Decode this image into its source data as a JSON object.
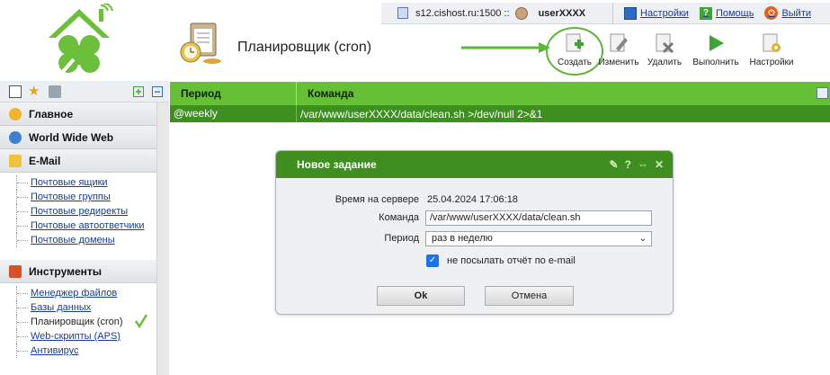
{
  "header": {
    "server": "s12.cishost.ru:1500 ::",
    "user": "userXXXX",
    "links": {
      "settings": "Настройки",
      "help": "Помощь",
      "logout": "Выйти"
    }
  },
  "page": {
    "title": "Планировщик (cron)"
  },
  "toolbar": {
    "create": "Создать",
    "edit": "Изменить",
    "delete": "Удалить",
    "run": "Выполнить",
    "settings": "Настройки"
  },
  "sidebar": {
    "sections": {
      "main": "Главное",
      "www": "World Wide Web",
      "email": "E-Mail",
      "tools": "Инструменты"
    },
    "email_items": [
      "Почтовые ящики",
      "Почтовые группы",
      "Почтовые редиректы",
      "Почтовые автоответчики",
      "Почтовые домены"
    ],
    "tools_items": [
      "Менеджер файлов",
      "Базы данных",
      "Планировщик (cron)",
      "Web-скрипты (APS)",
      "Антивирус"
    ]
  },
  "table": {
    "columns": [
      "Период",
      "Команда"
    ],
    "rows": [
      {
        "period": "@weekly",
        "command": "/var/www/userXXXX/data/clean.sh >/dev/null 2>&1"
      }
    ]
  },
  "dialog": {
    "title": "Новое задание",
    "server_time_label": "Время на сервере",
    "server_time": "25.04.2024 17:06:18",
    "command_label": "Команда",
    "command_value": "/var/www/userXXXX/data/clean.sh",
    "period_label": "Период",
    "period_value": "раз в неделю",
    "no_mail_label": "не посылать отчёт по e-mail",
    "no_mail_checked": true,
    "ok": "Ok",
    "cancel": "Отмена"
  },
  "colors": {
    "accent_green": "#66c035",
    "dark_green": "#3d8f1f",
    "link": "#1a3d8f"
  }
}
